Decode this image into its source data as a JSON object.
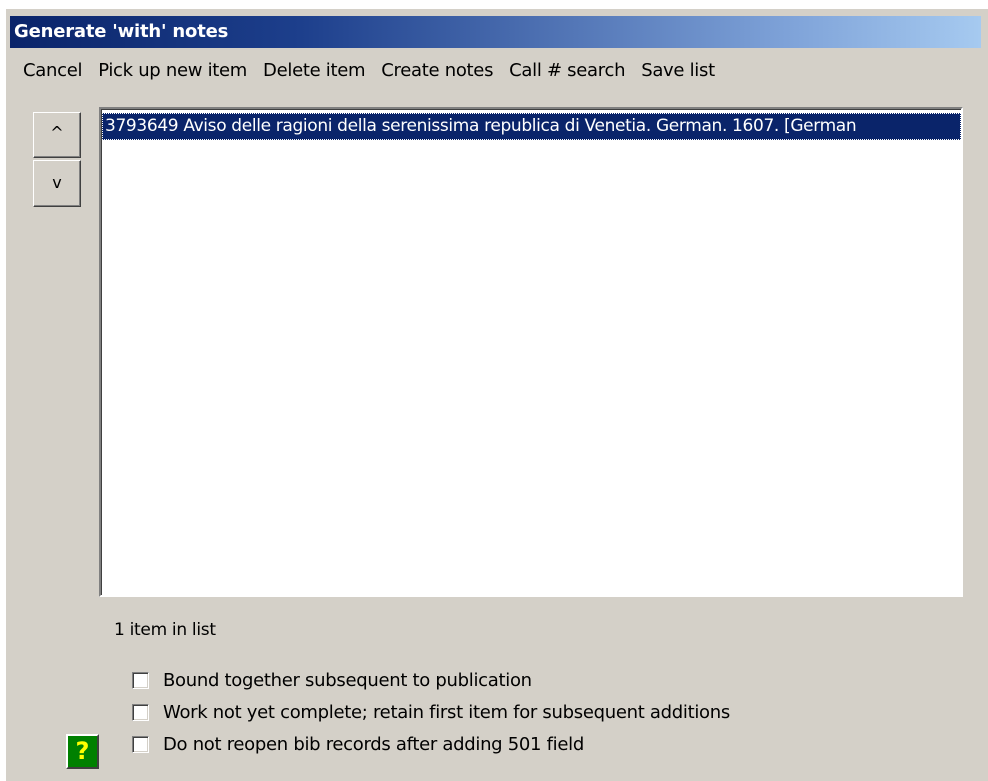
{
  "window": {
    "title": "Generate 'with' notes"
  },
  "menu": {
    "items": [
      {
        "label": "Cancel"
      },
      {
        "label": "Pick up new item"
      },
      {
        "label": "Delete item"
      },
      {
        "label": "Create notes"
      },
      {
        "label": "Call # search"
      },
      {
        "label": "Save list"
      }
    ]
  },
  "order_buttons": {
    "up_label": "^",
    "down_label": "v"
  },
  "list": {
    "items": [
      {
        "text": "3793649 Aviso delle ragioni della serenissima republica di Venetia. German. 1607. [German",
        "selected": true
      }
    ]
  },
  "status": {
    "text": "1 item in list"
  },
  "options": [
    {
      "label": "Bound together subsequent to publication",
      "checked": false
    },
    {
      "label": "Work not yet complete; retain first item for subsequent additions",
      "checked": false
    },
    {
      "label": "Do not reopen bib records after adding 501 field",
      "checked": false
    }
  ],
  "help": {
    "label": "?",
    "icon": "help-icon"
  },
  "colors": {
    "title_gradient_start": "#0a246a",
    "title_gradient_end": "#a6caf0",
    "selection": "#0a246a",
    "help_bg": "#008000",
    "help_fg": "#ffff00"
  }
}
